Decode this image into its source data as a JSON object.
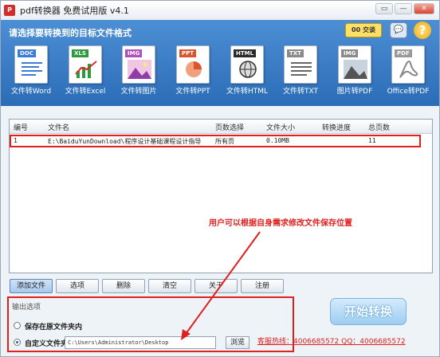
{
  "window": {
    "title": "pdf转换器 免费试用版 v4.1",
    "controls": [
      "▭",
      "—",
      "✕"
    ]
  },
  "header": {
    "prompt": "请选择要转换到的目标文件格式",
    "qq_badge": "00 交谈",
    "chat_icon_glyph": "💬",
    "help_glyph": "?"
  },
  "tools": [
    {
      "tag": "DOC",
      "label": "文件转Word",
      "color": "#3a7ad9"
    },
    {
      "tag": "XLS",
      "label": "文件转Excel",
      "color": "#2e9a3d"
    },
    {
      "tag": "IMG",
      "label": "文件转图片",
      "color": "#b04fbd"
    },
    {
      "tag": "PPT",
      "label": "文件转PPT",
      "color": "#d8562e"
    },
    {
      "tag": "HTML",
      "label": "文件转HTML",
      "color": "#2a2a2a"
    },
    {
      "tag": "TXT",
      "label": "文件转TXT",
      "color": "#8a8a8a"
    },
    {
      "tag": "IMG",
      "label": "图片转PDF",
      "color": "#8a8a8a"
    },
    {
      "tag": "PDF",
      "label": "Office转PDF",
      "color": "#999999"
    }
  ],
  "list": {
    "columns": [
      "编号",
      "文件名",
      "页数选择",
      "文件大小",
      "转换进度",
      "总页数"
    ],
    "rows": [
      {
        "no": "1",
        "filename": "E:\\BaiduYunDownload\\程序设计基础课程设计指导",
        "pages": "所有页",
        "size": "0.10MB",
        "progress": "",
        "total": "11"
      }
    ]
  },
  "buttons": {
    "add": "添加文件",
    "select": "选项",
    "delete": "删除",
    "clear": "清空",
    "about": "关于",
    "register": "注册"
  },
  "output": {
    "title": "输出选项",
    "option_original": "保存在原文件夹内",
    "option_custom": "自定义文件夹",
    "custom_path": "C:\\Users\\Administrator\\Desktop",
    "browse": "浏览"
  },
  "start": "开始转换",
  "hotline": "客服热线：4006685572 QQ：4006685572",
  "annotation": "用户可以根据自身需求修改文件保存位置"
}
